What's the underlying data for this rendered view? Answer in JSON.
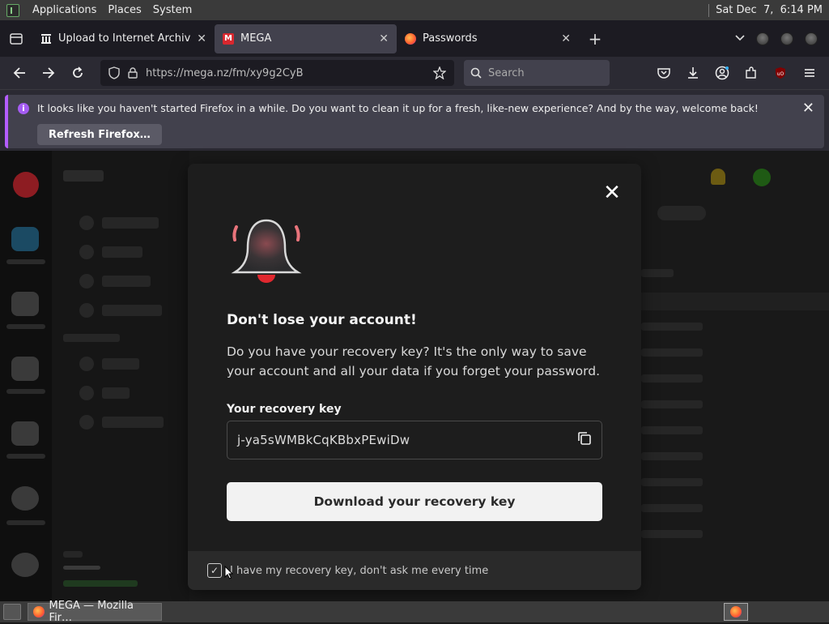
{
  "top_panel": {
    "menus": [
      "Applications",
      "Places",
      "System"
    ],
    "clock": "Sat Dec  7,  6:14 PM"
  },
  "tabs": [
    {
      "title": "Upload to Internet Archive",
      "active": false,
      "icon": "archive-icon"
    },
    {
      "title": "MEGA",
      "active": true,
      "icon": "mega-icon"
    },
    {
      "title": "Passwords",
      "active": false,
      "icon": "firefox-icon"
    }
  ],
  "navbar": {
    "url": "https://mega.nz/fm/xy9g2CyB",
    "search_placeholder": "Search"
  },
  "notification": {
    "message": "It looks like you haven't started Firefox in a while. Do you want to clean it up for a fresh, like-new experience? And by the way, welcome back!",
    "button_label": "Refresh Firefox…"
  },
  "modal": {
    "title": "Don't lose your account!",
    "description": "Do you have your recovery key? It's the only way to save your account and all your data if you forget your password.",
    "key_label": "Your recovery key",
    "key_value": "j-ya5sWMBkCqKBbxPEwiDw",
    "download_label": "Download your recovery key",
    "dont_ask_label": "I have my recovery key, don't ask me every time",
    "dont_ask_checked": true
  },
  "taskbar": {
    "window_title": "MEGA — Mozilla Fir…"
  },
  "colors": {
    "modal_bg": "#1d1d1d",
    "download_button_bg": "#f2f2f2",
    "notification_accent": "#b35dff",
    "mega_red": "#d9272e"
  }
}
